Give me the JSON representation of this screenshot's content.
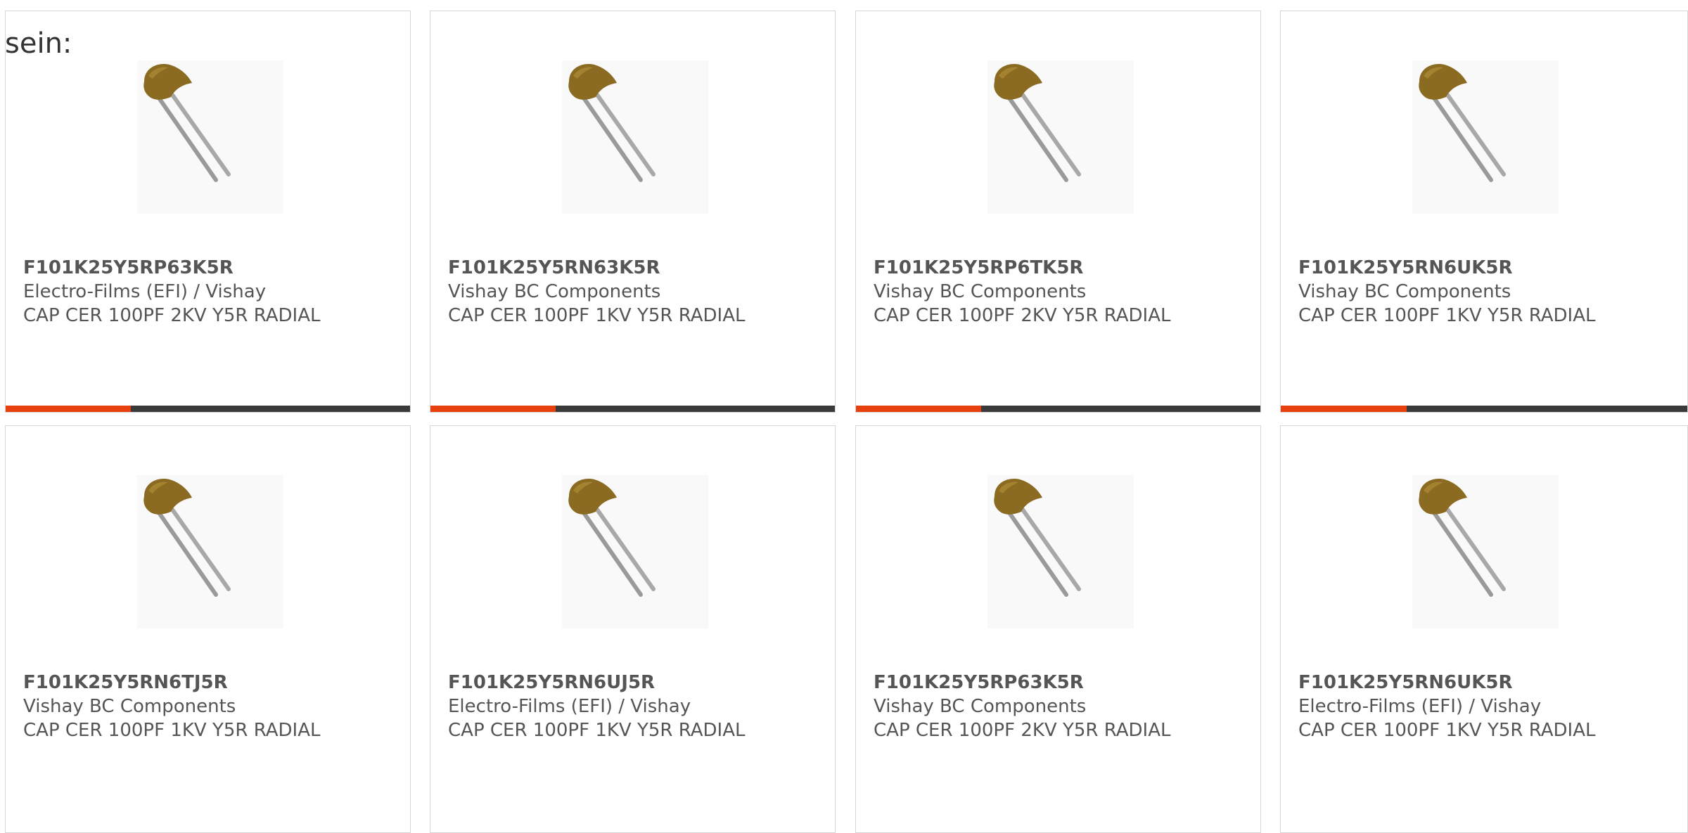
{
  "intro_text": "sein:",
  "colors": {
    "accent": "#e8400c",
    "bar_track": "#3a3a3a",
    "text": "#555555",
    "border": "#d6d6d6"
  },
  "cards": [
    {
      "part_number": "F101K25Y5RP63K5R",
      "manufacturer": "Electro-Films (EFI) / Vishay",
      "description": "CAP CER 100PF 2KV Y5R RADIAL",
      "image_icon": "ceramic-capacitor-icon",
      "progress_fraction": 0.31
    },
    {
      "part_number": "F101K25Y5RN63K5R",
      "manufacturer": "Vishay BC Components",
      "description": "CAP CER 100PF 1KV Y5R RADIAL",
      "image_icon": "ceramic-capacitor-icon",
      "progress_fraction": 0.31
    },
    {
      "part_number": "F101K25Y5RP6TK5R",
      "manufacturer": "Vishay BC Components",
      "description": "CAP CER 100PF 2KV Y5R RADIAL",
      "image_icon": "ceramic-capacitor-icon",
      "progress_fraction": 0.31
    },
    {
      "part_number": "F101K25Y5RN6UK5R",
      "manufacturer": "Vishay BC Components",
      "description": "CAP CER 100PF 1KV Y5R RADIAL",
      "image_icon": "ceramic-capacitor-icon",
      "progress_fraction": 0.31
    },
    {
      "part_number": "F101K25Y5RN6TJ5R",
      "manufacturer": "Vishay BC Components",
      "description": "CAP CER 100PF 1KV Y5R RADIAL",
      "image_icon": "ceramic-capacitor-icon",
      "progress_fraction": null
    },
    {
      "part_number": "F101K25Y5RN6UJ5R",
      "manufacturer": "Electro-Films (EFI) / Vishay",
      "description": "CAP CER 100PF 1KV Y5R RADIAL",
      "image_icon": "ceramic-capacitor-icon",
      "progress_fraction": null
    },
    {
      "part_number": "F101K25Y5RP63K5R",
      "manufacturer": "Vishay BC Components",
      "description": "CAP CER 100PF 2KV Y5R RADIAL",
      "image_icon": "ceramic-capacitor-icon",
      "progress_fraction": null
    },
    {
      "part_number": "F101K25Y5RN6UK5R",
      "manufacturer": "Electro-Films (EFI) / Vishay",
      "description": "CAP CER 100PF 1KV Y5R RADIAL",
      "image_icon": "ceramic-capacitor-icon",
      "progress_fraction": null
    }
  ]
}
